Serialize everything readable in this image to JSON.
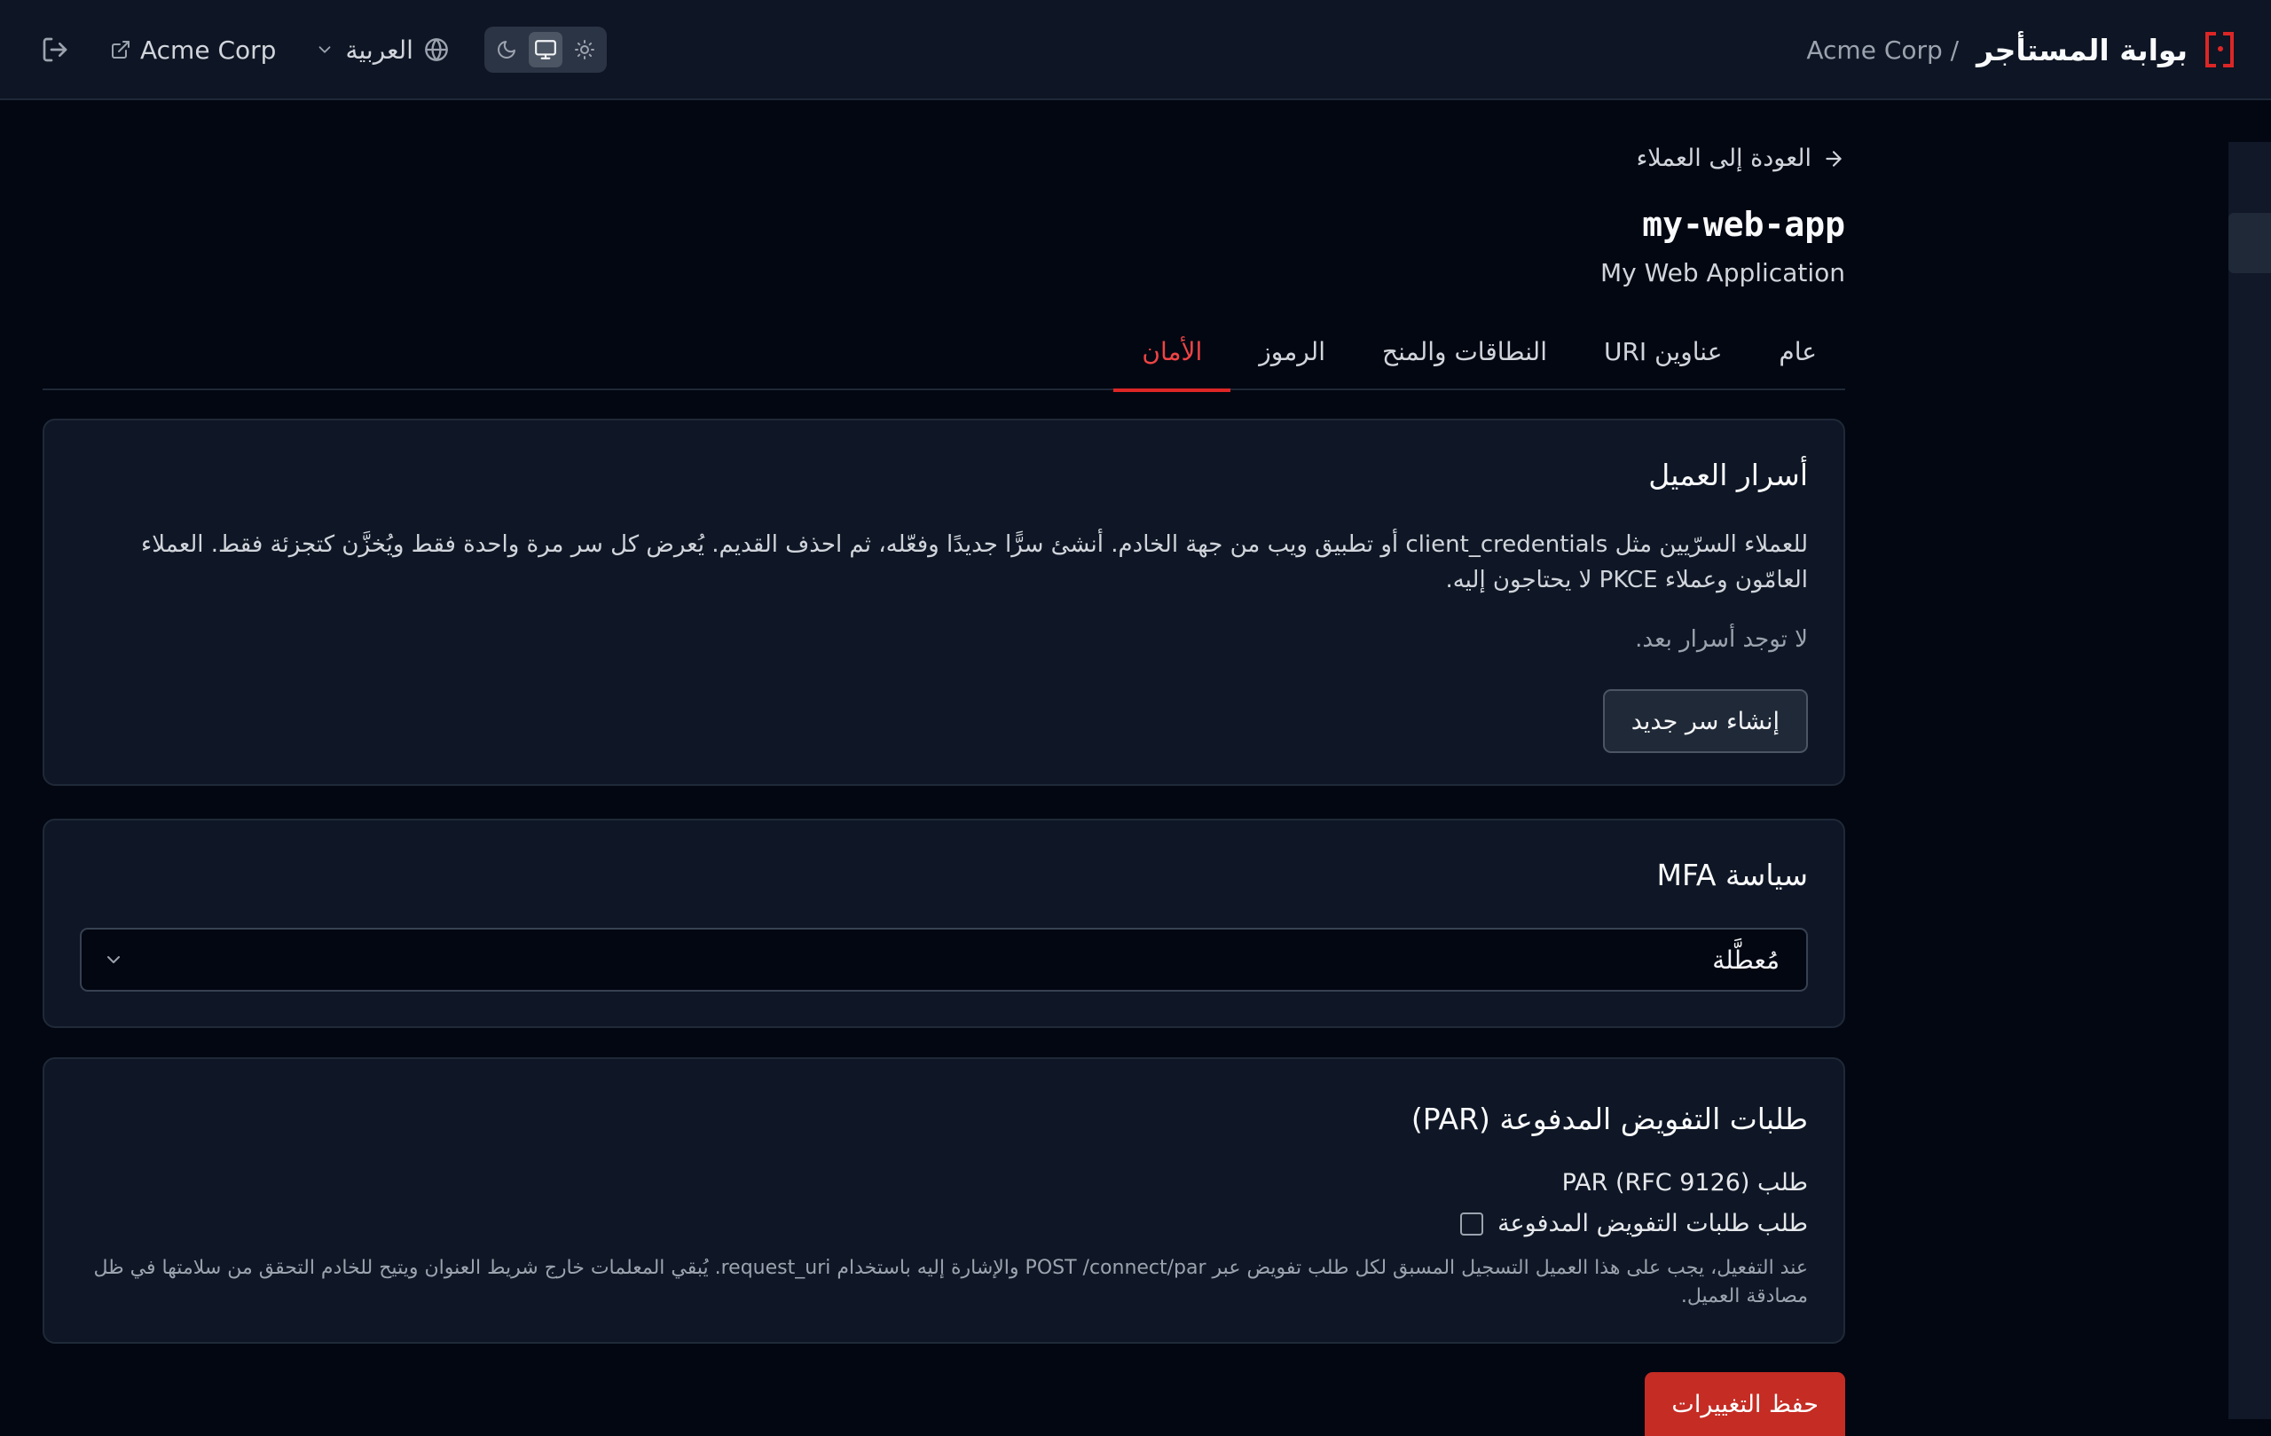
{
  "header": {
    "portal_title": "بوابة المستأجر",
    "tenant_crumb": "Acme Corp /",
    "tenant_link": "Acme Corp",
    "language": "العربية",
    "icons": {
      "logo": "bracket-dot-logo-icon",
      "logout": "logout-icon",
      "external": "external-link-icon",
      "language": "globe-icon",
      "language_caret": "chevron-down-icon",
      "theme_dark": "moon-icon",
      "theme_system": "monitor-icon",
      "theme_light": "sun-icon"
    },
    "theme_selected": "system"
  },
  "page": {
    "back_link": "العودة إلى العملاء",
    "client_id": "my-web-app",
    "client_name": "My Web Application"
  },
  "tabs": [
    {
      "label": "عام",
      "active": false
    },
    {
      "label": "عناوين URI",
      "active": false
    },
    {
      "label": "النطاقات والمنح",
      "active": false
    },
    {
      "label": "الرموز",
      "active": false
    },
    {
      "label": "الأمان",
      "active": true
    }
  ],
  "secrets": {
    "title": "أسرار العميل",
    "description": "للعملاء السرّيين مثل client_credentials أو تطبيق ويب من جهة الخادم. أنشئ سرًّا جديدًا وفعّله، ثم احذف القديم. يُعرض كل سر مرة واحدة فقط ويُخزَّن كتجزئة فقط. العملاء العامّون وعملاء PKCE لا يحتاجون إليه.",
    "empty": "لا توجد أسرار بعد.",
    "create_button": "إنشاء سر جديد"
  },
  "mfa": {
    "title": "سياسة MFA",
    "selected": "مُعطَّلة"
  },
  "par": {
    "title": "طلبات التفويض المدفوعة (PAR)",
    "label": "طلب PAR (RFC 9126)",
    "checkbox_label": "طلب طلبات التفويض المدفوعة",
    "checked": false,
    "help": "عند التفعيل، يجب على هذا العميل التسجيل المسبق لكل طلب تفويض عبر POST /connect/par والإشارة إليه باستخدام request_uri. يُبقي المعلمات خارج شريط العنوان ويتيح للخادم التحقق من سلامتها في ظل مصادقة العميل."
  },
  "actions": {
    "save": "حفظ التغييرات"
  },
  "colors": {
    "accent": "#dc2626",
    "background": "#030712",
    "surface": "#0f1726"
  }
}
